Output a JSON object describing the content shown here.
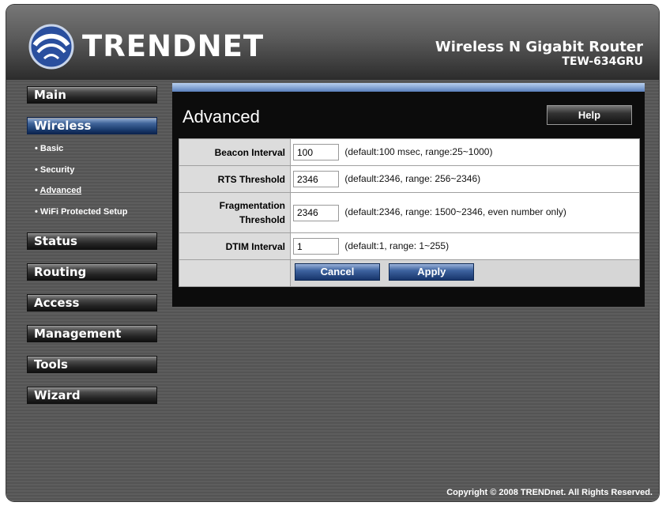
{
  "brand": {
    "logo_text": "TRENDNET",
    "product_name": "Wireless N Gigabit Router",
    "model": "TEW-634GRU"
  },
  "nav": {
    "main": "Main",
    "wireless": "Wireless",
    "wireless_sub": [
      "Basic",
      "Security",
      "Advanced",
      "WiFi Protected Setup"
    ],
    "status": "Status",
    "routing": "Routing",
    "access": "Access",
    "management": "Management",
    "tools": "Tools",
    "wizard": "Wizard"
  },
  "page": {
    "title": "Advanced",
    "help_label": "Help"
  },
  "form": {
    "beacon": {
      "label": "Beacon Interval",
      "value": "100",
      "hint": "(default:100 msec, range:25~1000)"
    },
    "rts": {
      "label": "RTS Threshold",
      "value": "2346",
      "hint": "(default:2346, range: 256~2346)"
    },
    "frag": {
      "label_line1": "Fragmentation",
      "label_line2": "Threshold",
      "value": "2346",
      "hint": "(default:2346, range: 1500~2346, even number only)"
    },
    "dtim": {
      "label": "DTIM Interval",
      "value": "1",
      "hint": "(default:1, range: 1~255)"
    },
    "cancel_label": "Cancel",
    "apply_label": "Apply"
  },
  "footer": {
    "copyright": "Copyright © 2008 TRENDnet. All Rights Reserved."
  },
  "colors": {
    "active_nav": "#2d5290",
    "content_bg": "#0c0c0c",
    "form_label_bg": "#dcdcdc"
  }
}
